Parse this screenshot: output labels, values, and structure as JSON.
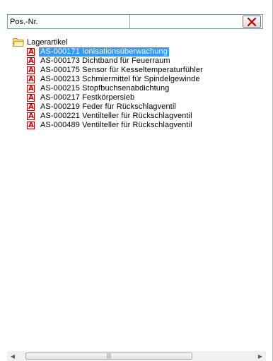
{
  "filter": {
    "label": "Pos.-Nr.",
    "value": "",
    "clear_icon": "close-x-icon"
  },
  "tree": {
    "root_label": "Lagerartikel",
    "root_icon": "folder-icon",
    "item_icon": "pdf-icon",
    "items": [
      {
        "label": "AS-000171 Ionisationsüberwachung",
        "selected": true
      },
      {
        "label": "AS-000173 Dichtband für Feuerraum",
        "selected": false
      },
      {
        "label": "AS-000175 Sensor für Kesseltemperaturfühler",
        "selected": false
      },
      {
        "label": "AS-000213 Schmiermittel für Spindelgewinde",
        "selected": false
      },
      {
        "label": "AS-000215 Stopfbuchsenabdichtung",
        "selected": false
      },
      {
        "label": "AS-000217 Festkörpersieb",
        "selected": false
      },
      {
        "label": "AS-000219 Feder für Rückschlagventil",
        "selected": false
      },
      {
        "label": "AS-000221 Ventilteller für Rückschlagventil",
        "selected": false
      },
      {
        "label": "AS-000489 Ventilteller für Rückschlagventil",
        "selected": false
      }
    ]
  },
  "colors": {
    "selection": "#3399ff",
    "pdf_icon_red": "#d00000",
    "clear_icon_red": "#c00000"
  }
}
